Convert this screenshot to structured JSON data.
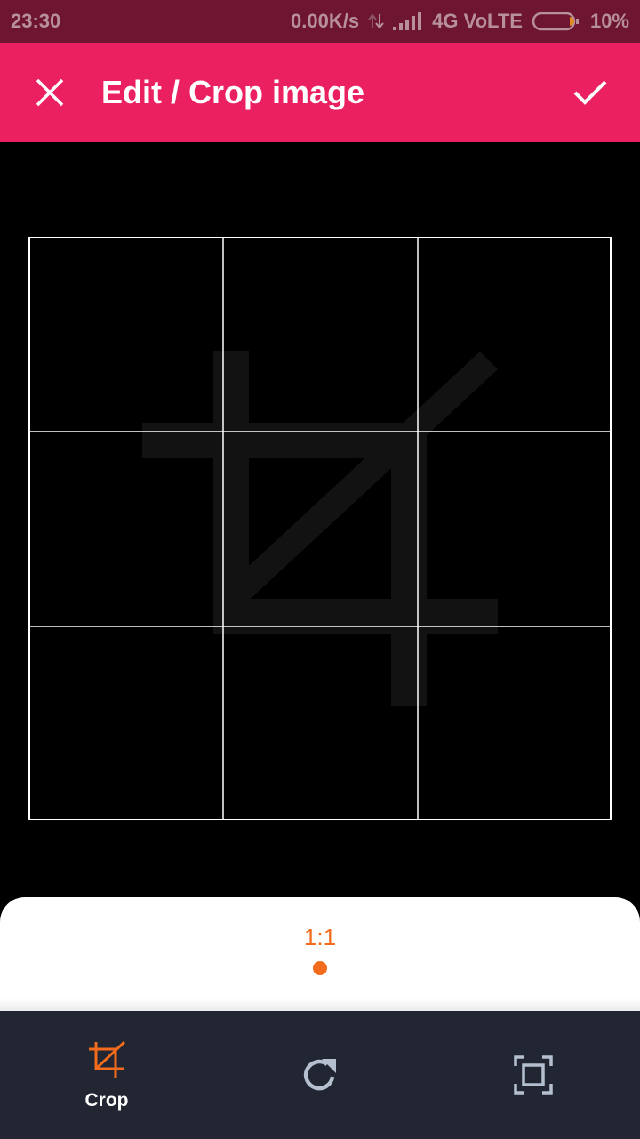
{
  "status_bar": {
    "time": "23:30",
    "net_speed": "0.00K/s",
    "network": "4G VoLTE",
    "battery": "10%"
  },
  "app_bar": {
    "title": "Edit / Crop image",
    "close_icon": "close-icon",
    "confirm_icon": "check-icon"
  },
  "crop": {
    "grid": "3x3",
    "placeholder_icon": "crop-icon"
  },
  "ratio_selector": {
    "selected": "1:1"
  },
  "bottom_nav": {
    "items": [
      {
        "label": "Crop",
        "icon": "crop-icon",
        "active": true
      },
      {
        "label": "",
        "icon": "rotate-icon",
        "active": false
      },
      {
        "label": "",
        "icon": "fit-screen-icon",
        "active": false
      }
    ]
  },
  "colors": {
    "status_bar": "#6d1531",
    "app_bar": "#ea2061",
    "accent": "#f36b1c",
    "bottom_nav": "#212632",
    "icon_inactive": "#b4c0cf"
  }
}
